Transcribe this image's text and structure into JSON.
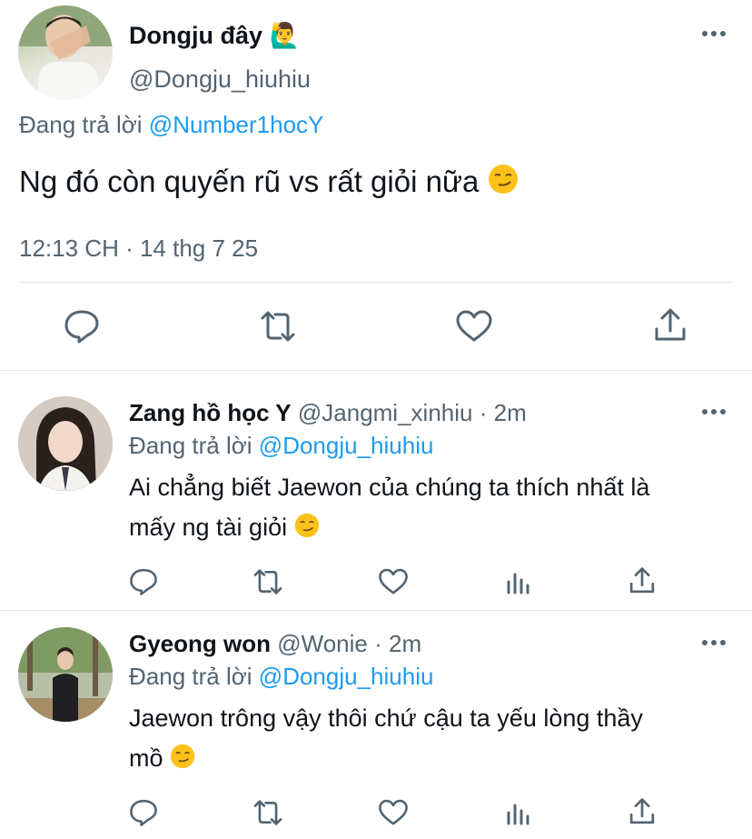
{
  "main_tweet": {
    "display_name": "Dongju đây 🙋‍♂️",
    "handle": "@Dongju_hiuhiu",
    "replying_prefix": "Đang trả lời",
    "replying_to": "@Number1hocY",
    "text": "Ng đó còn quyến rũ vs rất giỏi nữa",
    "emoji": "smirk",
    "timestamp": "12:13 CH · 14 thg 7 25",
    "actions": [
      "reply",
      "retweet",
      "like",
      "share"
    ]
  },
  "replies": [
    {
      "display_name": "Zang hồ học Y",
      "handle": "@Jangmi_xinhiu",
      "separator": "·",
      "time": "2m",
      "replying_prefix": "Đang trả lời",
      "replying_to": "@Dongju_hiuhiu",
      "text_line1": "Ai chẳng biết Jaewon của chúng ta thích nhất là",
      "text_line2": "mấy ng tài giỏi",
      "emoji": "smirk",
      "actions": [
        "reply",
        "retweet",
        "like",
        "views",
        "share"
      ]
    },
    {
      "display_name": "Gyeong won",
      "handle": "@Wonie",
      "separator": "·",
      "time": "2m",
      "replying_prefix": "Đang trả lời",
      "replying_to": "@Dongju_hiuhiu",
      "text_line1": "Jaewon trông vậy thôi chứ cậu ta yếu lòng thầy",
      "text_line2": "mồ",
      "emoji": "smirk",
      "actions": [
        "reply",
        "retweet",
        "like",
        "views",
        "share"
      ]
    }
  ],
  "colors": {
    "text": "#0f1419",
    "secondary": "#536471",
    "link": "#1d9bf0",
    "divider": "#e1e6ea"
  }
}
